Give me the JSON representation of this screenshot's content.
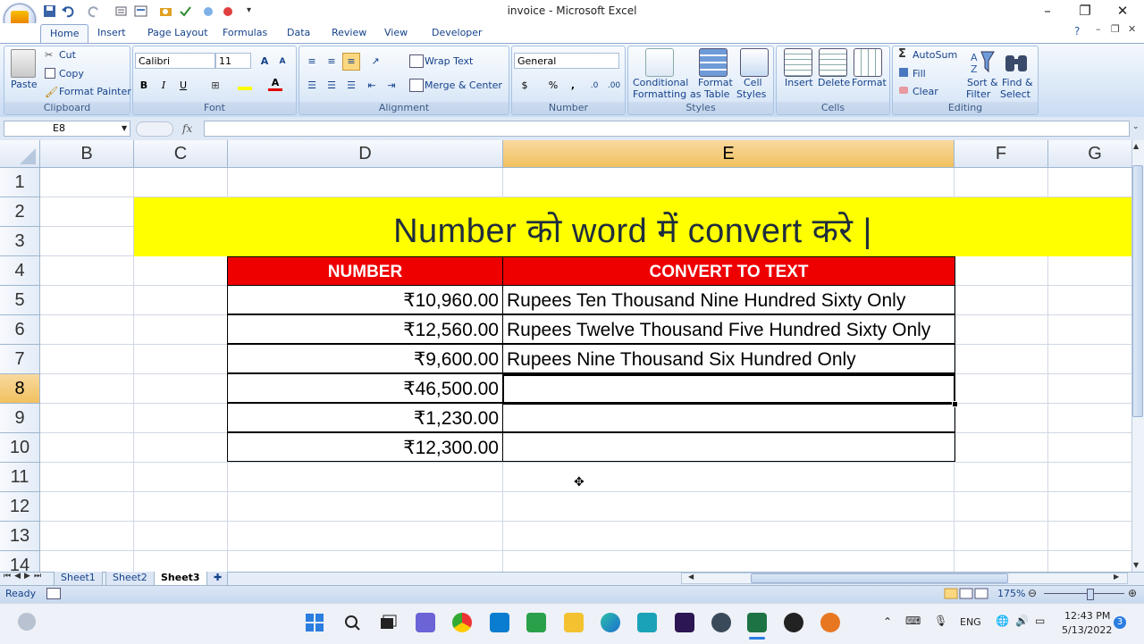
{
  "window": {
    "title": "invoice - Microsoft Excel",
    "minimize": "–",
    "maximize": "❐",
    "close": "✕"
  },
  "tabs": [
    "Home",
    "Insert",
    "Page Layout",
    "Formulas",
    "Data",
    "Review",
    "View",
    "Developer"
  ],
  "active_tab": "Home",
  "ribbon": {
    "clipboard": {
      "paste": "Paste",
      "cut": "Cut",
      "copy": "Copy",
      "format_painter": "Format Painter",
      "title": "Clipboard"
    },
    "font": {
      "name": "Calibri",
      "size": "11",
      "title": "Font",
      "bold": "B",
      "italic": "I",
      "underline": "U"
    },
    "alignment": {
      "wrap_text": "Wrap Text",
      "merge_center": "Merge & Center",
      "title": "Alignment"
    },
    "number": {
      "format": "General",
      "currency": "$",
      "percent": "%",
      "comma": ",",
      "title": "Number"
    },
    "styles": {
      "conditional_l1": "Conditional",
      "conditional_l2": "Formatting",
      "format_table_l1": "Format",
      "format_table_l2": "as Table",
      "cell_styles_l1": "Cell",
      "cell_styles_l2": "Styles",
      "title": "Styles"
    },
    "cells": {
      "insert": "Insert",
      "delete": "Delete",
      "format": "Format",
      "title": "Cells"
    },
    "editing": {
      "autosum": "AutoSum",
      "fill": "Fill",
      "clear": "Clear",
      "sort_l1": "Sort &",
      "sort_l2": "Filter",
      "find_l1": "Find &",
      "find_l2": "Select",
      "title": "Editing"
    }
  },
  "formula_bar": {
    "name_box": "E8",
    "fx": "fx",
    "value": ""
  },
  "columns": [
    "B",
    "C",
    "D",
    "E",
    "F",
    "G"
  ],
  "selected_column": "E",
  "rows": [
    "1",
    "2",
    "3",
    "4",
    "5",
    "6",
    "7",
    "8",
    "9",
    "10",
    "11",
    "12",
    "13",
    "14"
  ],
  "selected_row": "8",
  "sheet": {
    "banner": "Number को  word में convert करे |",
    "headers": {
      "number": "NUMBER",
      "text": "CONVERT TO TEXT"
    },
    "data_rows": [
      {
        "number": "₹10,960.00",
        "text": "Rupees Ten Thousand Nine Hundred Sixty Only"
      },
      {
        "number": "₹12,560.00",
        "text": "Rupees Twelve Thousand Five Hundred Sixty Only"
      },
      {
        "number": "₹9,600.00",
        "text": "Rupees Nine Thousand Six Hundred  Only"
      },
      {
        "number": "₹46,500.00",
        "text": ""
      },
      {
        "number": "₹1,230.00",
        "text": ""
      },
      {
        "number": "₹12,300.00",
        "text": ""
      }
    ]
  },
  "sheet_tabs": [
    "Sheet1",
    "Sheet2",
    "Sheet3"
  ],
  "active_sheet": "Sheet3",
  "status": {
    "ready": "Ready",
    "zoom": "175%"
  },
  "tray": {
    "lang": "ENG",
    "time": "12:43 PM",
    "date": "5/13/2022",
    "badge": "3"
  },
  "colors": {
    "banner": "#ffff00",
    "header": "#ee0000",
    "selection": "#f1c15f"
  }
}
